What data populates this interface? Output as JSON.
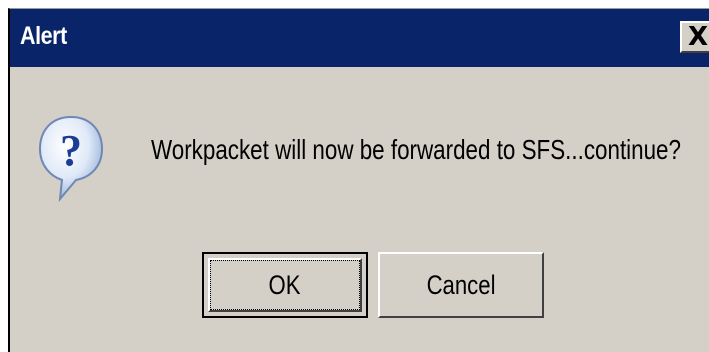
{
  "window": {
    "title": "Alert",
    "close_label": "X"
  },
  "message": {
    "text": "Workpacket will now be forwarded to SFS...continue?",
    "icon": "question-icon"
  },
  "buttons": {
    "ok_label": "OK",
    "cancel_label": "Cancel"
  },
  "colors": {
    "titlebar": "#0a246a",
    "dialog_bg": "#d4d0c8",
    "icon_bubble": "#e8f0fb",
    "icon_mark": "#1d3c96"
  }
}
